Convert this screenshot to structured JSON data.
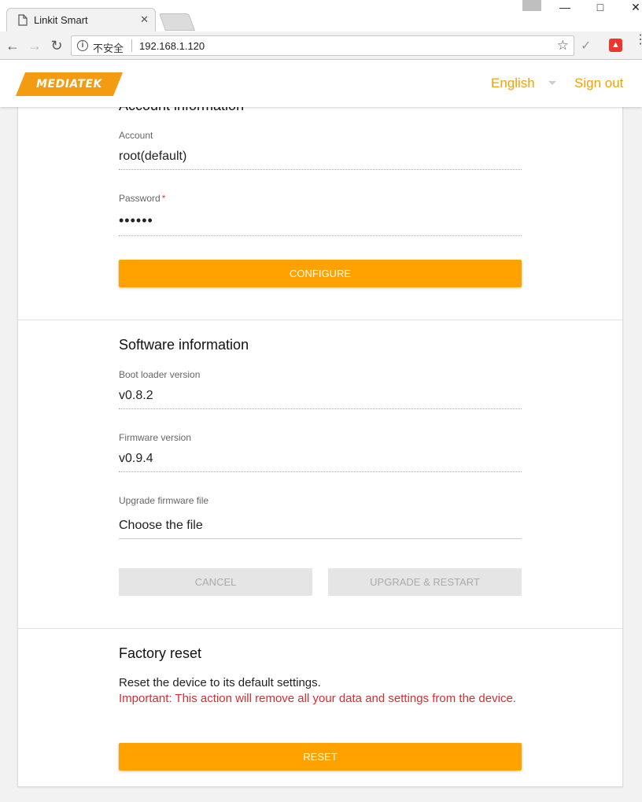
{
  "browser": {
    "tab_title": "Linkit Smart",
    "tab_close": "✕",
    "security_label": "不安全",
    "url": "192.168.1.120"
  },
  "header": {
    "logo_text": "MEDIATEK",
    "language": "English",
    "signout": "Sign out"
  },
  "account": {
    "title": "Account information",
    "account_label": "Account",
    "account_value": "root(default)",
    "password_label": "Password",
    "password_required": "*",
    "password_value": "••••••",
    "configure_label": "CONFIGURE"
  },
  "software": {
    "title": "Software information",
    "bootloader_label": "Boot loader version",
    "bootloader_value": "v0.8.2",
    "firmware_label": "Firmware version",
    "firmware_value": "v0.9.4",
    "upgrade_label": "Upgrade firmware file",
    "upgrade_value": "Choose the file",
    "cancel_label": "CANCEL",
    "upgrade_button_label": "UPGRADE & RESTART"
  },
  "factory": {
    "title": "Factory reset",
    "description": "Reset the device to its default settings.",
    "warning": "Important: This action will remove all your data and settings from the device.",
    "reset_label": "RESET"
  }
}
